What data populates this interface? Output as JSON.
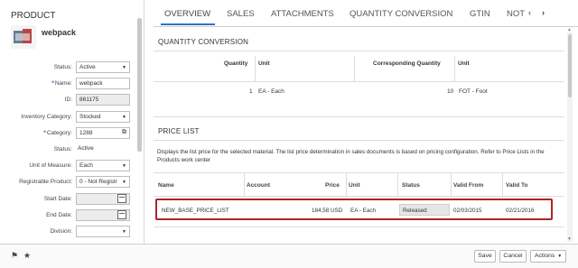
{
  "left": {
    "heading": "PRODUCT",
    "name": "webpack",
    "fields": [
      {
        "label": "Status:",
        "value": "Active",
        "kind": "select",
        "required": false
      },
      {
        "label": "Name:",
        "value": "webpack",
        "kind": "input",
        "required": true
      },
      {
        "label": "ID:",
        "value": "861175",
        "kind": "readonly",
        "required": false
      },
      {
        "label": "Inventory Category:",
        "value": "Stocked",
        "kind": "select",
        "required": false
      },
      {
        "label": "Category:",
        "value": "1288",
        "kind": "lookup",
        "required": true
      },
      {
        "label": "Status:",
        "value": "Active",
        "kind": "text",
        "required": false
      },
      {
        "label": "Unit of Measure:",
        "value": "Each",
        "kind": "select",
        "required": false
      },
      {
        "label": "Registrable Product:",
        "value": "0 - Not Registr",
        "kind": "select",
        "required": false
      },
      {
        "label": "Start Date:",
        "value": "",
        "kind": "date",
        "required": false
      },
      {
        "label": "End Date:",
        "value": "",
        "kind": "date",
        "required": false
      },
      {
        "label": "Division:",
        "value": "",
        "kind": "select",
        "required": false
      }
    ]
  },
  "tabs": [
    "OVERVIEW",
    "SALES",
    "ATTACHMENTS",
    "QUANTITY CONVERSION",
    "GTIN",
    "NOT"
  ],
  "quantity": {
    "title": "QUANTITY CONVERSION",
    "headers": [
      "Quantity",
      "Unit",
      "Corresponding Quantity",
      "Unit"
    ],
    "row": [
      "1",
      "EA - Each",
      "10",
      "FOT - Foot"
    ]
  },
  "price": {
    "title": "PRICE LIST",
    "description": "Displays the list price for the selected material. The list price determination in sales documents is based on pricing configuration. Refer to Price Lists in the Products work center",
    "headers": [
      "Name",
      "Account",
      "Price",
      "Unit",
      "Status",
      "Valid From",
      "Valid To"
    ],
    "row": [
      "NEW_BASE_PRICE_LIST",
      "",
      "184,58 USD",
      "EA - Each",
      "Released",
      "02/03/2015",
      "02/21/2016"
    ]
  },
  "footer": {
    "save": "Save",
    "cancel": "Cancel",
    "actions": "Actions"
  },
  "colors": {
    "accent": "#2a74c9",
    "highlight": "#b0232a"
  }
}
